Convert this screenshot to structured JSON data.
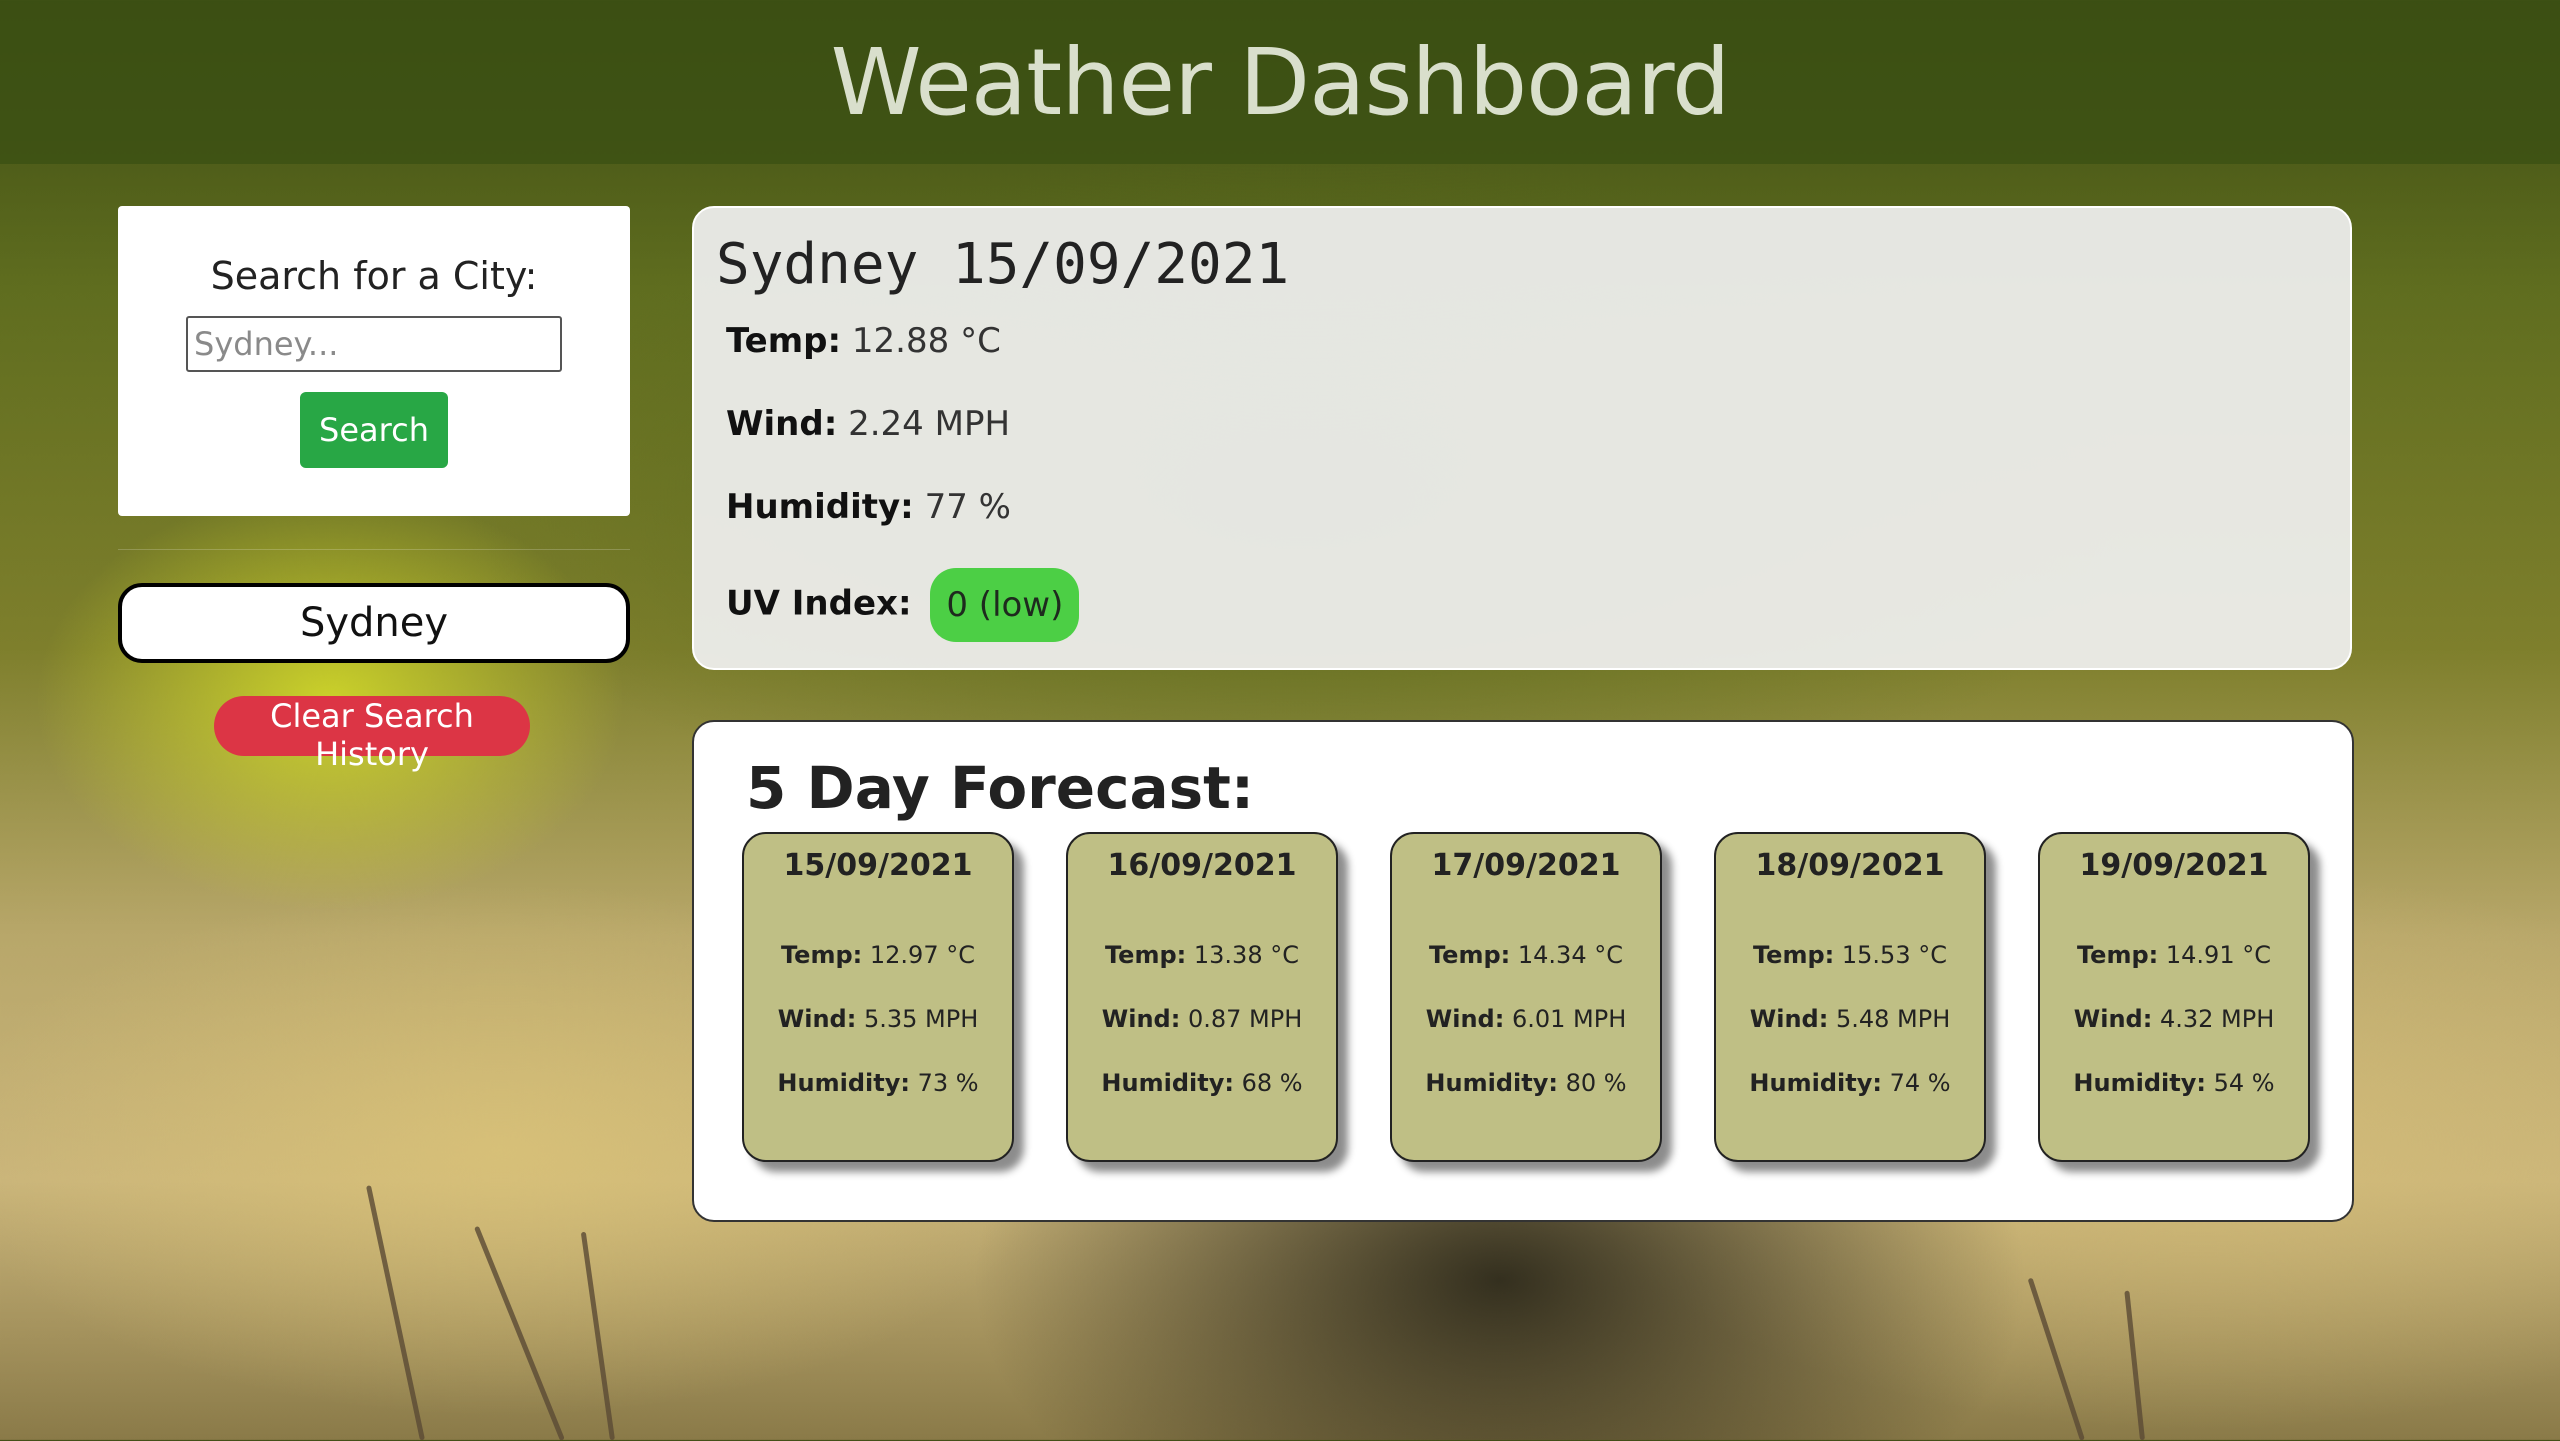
{
  "header": {
    "title": "Weather Dashboard"
  },
  "search": {
    "label": "Search for a City:",
    "placeholder": "Sydney...",
    "button_label": "Search"
  },
  "history": {
    "items": [
      "Sydney"
    ],
    "clear_label": "Clear Search History"
  },
  "current": {
    "city_date": "Sydney 15/09/2021",
    "temp_label": "Temp:",
    "temp_value": "12.88 °C",
    "wind_label": "Wind:",
    "wind_value": "2.24 MPH",
    "humidity_label": "Humidity:",
    "humidity_value": "77 %",
    "uv_label": "UV Index:",
    "uv_value": "0 (low)"
  },
  "forecast": {
    "title": "5 Day Forecast:",
    "labels": {
      "temp": "Temp:",
      "wind": "Wind:",
      "humidity": "Humidity:"
    },
    "days": [
      {
        "date": "15/09/2021",
        "temp": "12.97 °C",
        "wind": "5.35 MPH",
        "humidity": "73 %"
      },
      {
        "date": "16/09/2021",
        "temp": "13.38 °C",
        "wind": "0.87 MPH",
        "humidity": "68 %"
      },
      {
        "date": "17/09/2021",
        "temp": "14.34 °C",
        "wind": "6.01 MPH",
        "humidity": "80 %"
      },
      {
        "date": "18/09/2021",
        "temp": "15.53 °C",
        "wind": "5.48 MPH",
        "humidity": "74 %"
      },
      {
        "date": "19/09/2021",
        "temp": "14.91 °C",
        "wind": "4.32 MPH",
        "humidity": "54 %"
      }
    ]
  },
  "colors": {
    "search_button": "#28a745",
    "clear_button": "#dc3545",
    "uv_low": "#4ccf45",
    "forecast_card": "#bfbf85"
  }
}
